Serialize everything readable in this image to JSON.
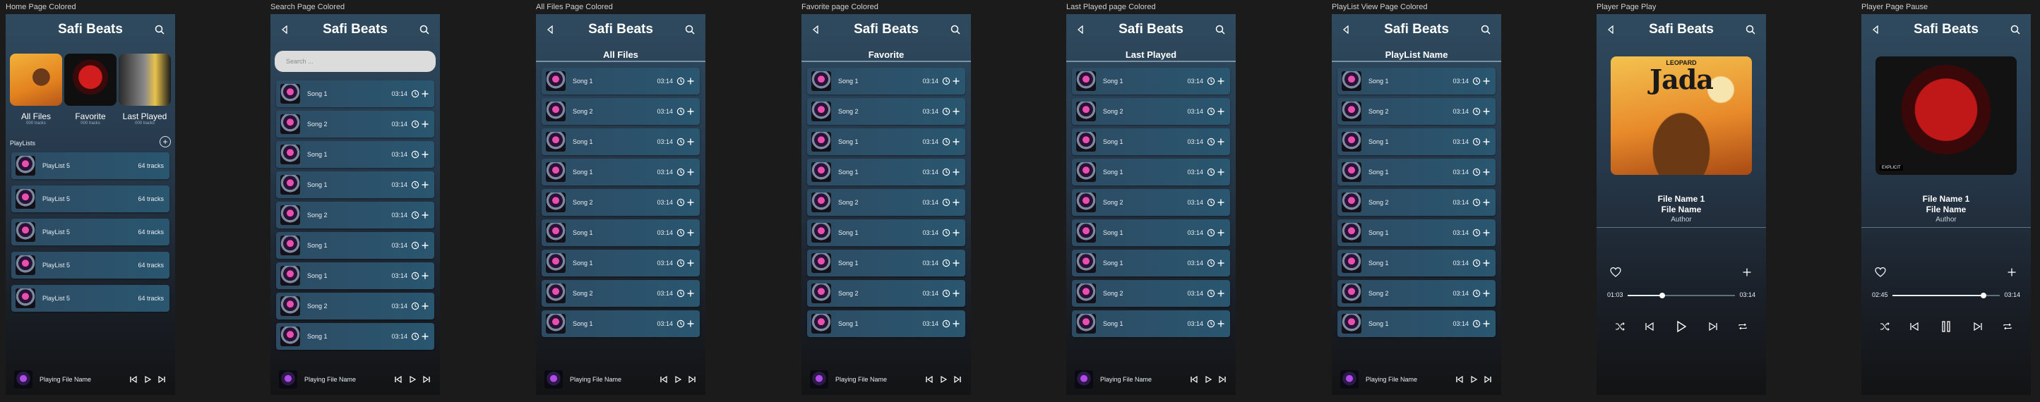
{
  "app_title": "Safi Beats",
  "song_time": "03:14",
  "tracks": "64 tracks",
  "search_placeholder": "Search ...",
  "playing_file_name": "Playing File Name",
  "frames": {
    "home": "Home Page Colored",
    "search": "Search Page Colored",
    "all_files": "All Files Page Colored",
    "favorite": "Favorite page Colored",
    "last_played": "Last Played page Colored",
    "playlist_view": "PlayList View Page Colored",
    "player_play": "Player Page Play",
    "player_pause": "Player Page Pause"
  },
  "home": {
    "albums": [
      {
        "label": "All Files",
        "sub": "000 tracks"
      },
      {
        "label": "Favorite",
        "sub": "000 tracks"
      },
      {
        "label": "Last Played",
        "sub": "000 tracks"
      }
    ],
    "playlists_label": "PlayLists",
    "playlists": [
      "PlayList 5",
      "PlayList 5",
      "PlayList 5",
      "PlayList 5",
      "PlayList 5"
    ]
  },
  "search": {
    "songs": [
      "Song 1",
      "Song 2",
      "Song 1",
      "Song 1",
      "Song 2",
      "Song 1",
      "Song 1",
      "Song 2",
      "Song 1"
    ]
  },
  "all_files": {
    "title": "All Files",
    "songs": [
      "Song 1",
      "Song 2",
      "Song 1",
      "Song 1",
      "Song 2",
      "Song 1",
      "Song 1",
      "Song 2",
      "Song 1"
    ]
  },
  "favorite": {
    "title": "Favorite",
    "songs": [
      "Song 1",
      "Song 2",
      "Song 1",
      "Song 1",
      "Song 2",
      "Song 1",
      "Song 1",
      "Song 2",
      "Song 1"
    ]
  },
  "last_played": {
    "title": "Last Played",
    "songs": [
      "Song 1",
      "Song 2",
      "Song 1",
      "Song 1",
      "Song 2",
      "Song 1",
      "Song 1",
      "Song 2",
      "Song 1"
    ]
  },
  "playlist_view": {
    "title": "PlayList Name",
    "songs": [
      "Song 1",
      "Song 2",
      "Song 1",
      "Song 1",
      "Song 2",
      "Song 1",
      "Song 1",
      "Song 2",
      "Song 1"
    ]
  },
  "player_play": {
    "cover_brand": "LEOPARD",
    "cover_title": "Jada",
    "file_name_1": "File Name 1",
    "file_name": "File Name",
    "author": "Author",
    "time_current": "01:03",
    "time_total": "03:14",
    "progress": 0.32
  },
  "player_pause": {
    "cover_badge": "EXPLICIT",
    "file_name_1": "File Name 1",
    "file_name": "File Name",
    "author": "Author",
    "time_current": "02:45",
    "time_total": "03:14",
    "progress": 0.85
  }
}
